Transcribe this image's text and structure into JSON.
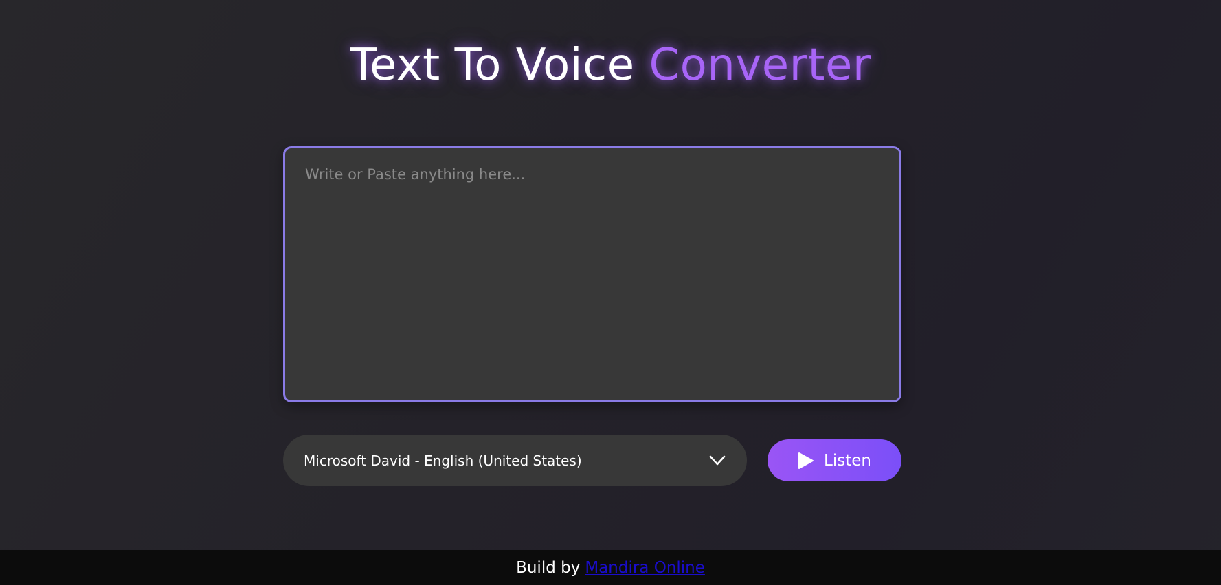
{
  "header": {
    "title_main": "Text To Voice ",
    "title_accent": "Converter"
  },
  "textarea": {
    "placeholder": "Write or Paste anything here...",
    "value": ""
  },
  "voice_select": {
    "selected": "Microsoft David - English (United States)",
    "icon": "chevron-down-icon"
  },
  "listen_button": {
    "label": "Listen",
    "icon": "play-icon"
  },
  "footer": {
    "prefix": "Build by",
    "link_text": "Mandira Online"
  },
  "colors": {
    "accent": "#a865f7",
    "textarea_border": "#8a7be6",
    "button_gradient_start": "#9a55f5",
    "button_gradient_end": "#7b4ff8",
    "link": "#1a0dcc"
  }
}
